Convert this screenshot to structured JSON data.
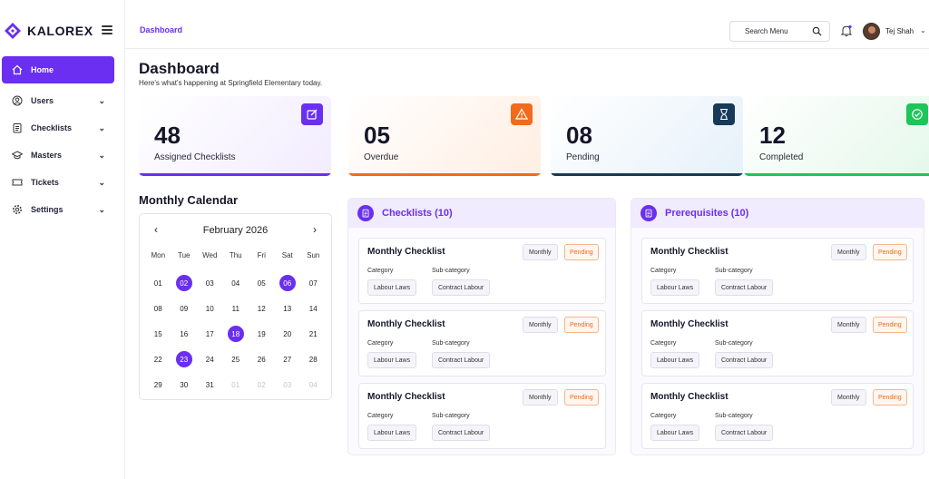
{
  "app": {
    "brand": "KALOREX"
  },
  "sidebar": {
    "items": [
      {
        "label": "Home",
        "icon": "home-icon"
      },
      {
        "label": "Users",
        "icon": "user-icon"
      },
      {
        "label": "Checklists",
        "icon": "clipboard-icon"
      },
      {
        "label": "Masters",
        "icon": "graduation-cap-icon"
      },
      {
        "label": "Tickets",
        "icon": "ticket-icon"
      },
      {
        "label": "Settings",
        "icon": "gear-icon"
      }
    ]
  },
  "topbar": {
    "breadcrumb": "Dashboard",
    "search_label": "Search Menu",
    "user_name": "Tej Shah"
  },
  "page": {
    "title": "Dashboard",
    "subtitle": "Here's what's happening at Springfield Elementary today."
  },
  "stats": [
    {
      "value": "48",
      "label": "Assigned Checklists",
      "icon": "edit-icon",
      "accent": "#6a2ff0"
    },
    {
      "value": "05",
      "label": "Overdue",
      "icon": "warning-icon",
      "accent": "#f26a1b"
    },
    {
      "value": "08",
      "label": "Pending",
      "icon": "hourglass-icon",
      "accent": "#173a5a"
    },
    {
      "value": "12",
      "label": "Completed",
      "icon": "check-circle-icon",
      "accent": "#1ec55a"
    }
  ],
  "calendar": {
    "title": "Monthly Calendar",
    "month": "February 2026",
    "prev": "‹",
    "next": "›",
    "weekdays": [
      "Mon",
      "Tue",
      "Wed",
      "Thu",
      "Fri",
      "Sat",
      "Sun"
    ],
    "weeks": [
      [
        "01",
        "02",
        "03",
        "04",
        "05",
        "06",
        "07"
      ],
      [
        "08",
        "09",
        "10",
        "11",
        "12",
        "13",
        "14"
      ],
      [
        "15",
        "16",
        "17",
        "18",
        "19",
        "20",
        "21"
      ],
      [
        "22",
        "23",
        "24",
        "25",
        "26",
        "27",
        "28"
      ],
      [
        "29",
        "30",
        "31",
        "01",
        "02",
        "03",
        "04"
      ]
    ],
    "highlighted": [
      "02",
      "06",
      "18",
      "23"
    ]
  },
  "checklists_panel": {
    "title": "Checklists (10)",
    "items": [
      {
        "title": "Monthly Checklist",
        "frequency": "Monthly",
        "status": "Pending",
        "category_label": "Category",
        "subcategory_label": "Sub-category",
        "category": "Labour Laws",
        "subcategory": "Contract Labour"
      },
      {
        "title": "Monthly Checklist",
        "frequency": "Monthly",
        "status": "Pending",
        "category_label": "Category",
        "subcategory_label": "Sub-category",
        "category": "Labour Laws",
        "subcategory": "Contract Labour"
      },
      {
        "title": "Monthly Checklist",
        "frequency": "Monthly",
        "status": "Pending",
        "category_label": "Category",
        "subcategory_label": "Sub-category",
        "category": "Labour Laws",
        "subcategory": "Contract Labour"
      }
    ]
  },
  "prerequisites_panel": {
    "title": "Prerequisites (10)",
    "items": [
      {
        "title": "Monthly Checklist",
        "frequency": "Monthly",
        "status": "Pending",
        "category_label": "Category",
        "subcategory_label": "Sub-category",
        "category": "Labour Laws",
        "subcategory": "Contract Labour"
      },
      {
        "title": "Monthly Checklist",
        "frequency": "Monthly",
        "status": "Pending",
        "category_label": "Category",
        "subcategory_label": "Sub-category",
        "category": "Labour Laws",
        "subcategory": "Contract Labour"
      },
      {
        "title": "Monthly Checklist",
        "frequency": "Monthly",
        "status": "Pending",
        "category_label": "Category",
        "subcategory_label": "Sub-category",
        "category": "Labour Laws",
        "subcategory": "Contract Labour"
      }
    ]
  }
}
